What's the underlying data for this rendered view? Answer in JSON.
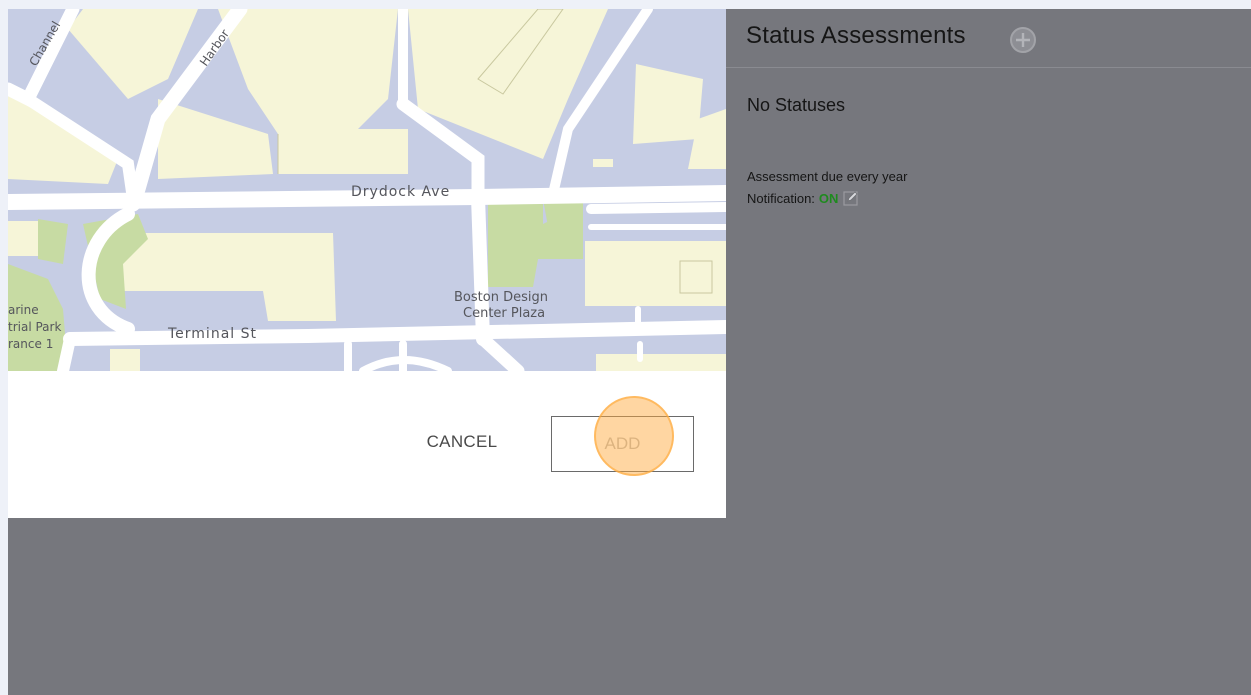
{
  "map": {
    "streets": {
      "drydock": "Drydock Ave",
      "terminal": "Terminal St",
      "channel": "Channel",
      "harbor": "Harbor"
    },
    "places": {
      "design_center_line1": "Boston Design",
      "design_center_line2": "Center Plaza",
      "marine_line1": "arine",
      "marine_line2": "trial Park",
      "marine_line3": "rance 1"
    }
  },
  "dialog": {
    "cancel_label": "CANCEL",
    "add_label": "ADD"
  },
  "panel": {
    "title": "Status Assessments",
    "empty_text": "No Statuses",
    "assessment_due": "Assessment due every year",
    "notification_label": "Notification:",
    "notification_value": "ON"
  },
  "colors": {
    "notification_on": "#1f8a1f",
    "panel_bg": "#76777d",
    "click_marker": "#ffaa3c"
  },
  "icons": {
    "add_status": "plus-circle-icon",
    "edit_notification": "edit-icon"
  }
}
